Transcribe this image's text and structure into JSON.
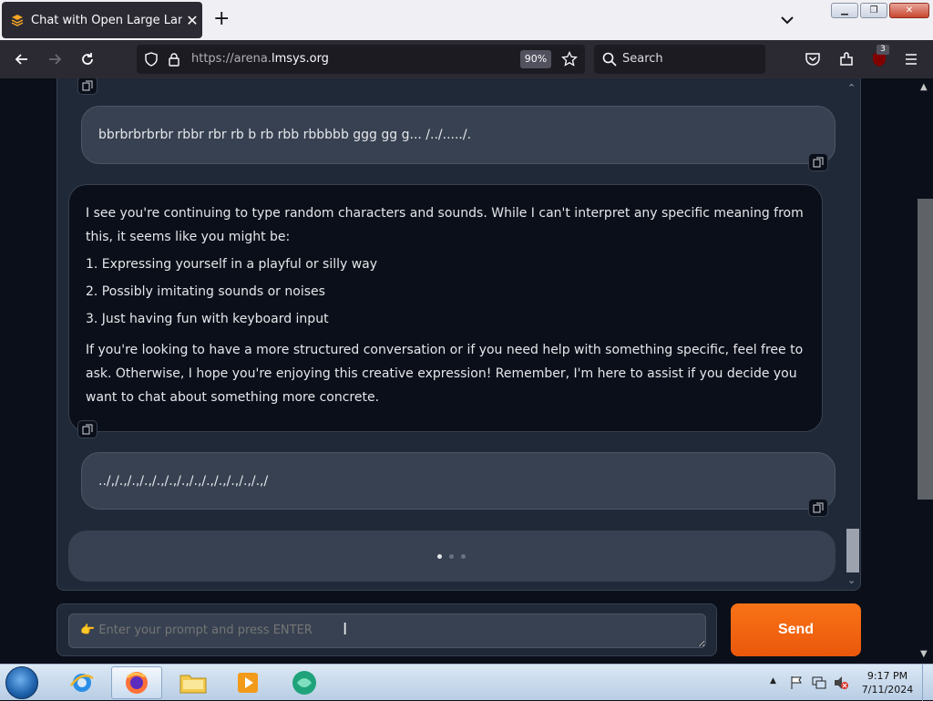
{
  "browser": {
    "tab_title": "Chat with Open Large Languag",
    "url_prefix": "https://arena.",
    "url_domain": "lmsys.org",
    "zoom": "90%",
    "search_placeholder": "Search",
    "extension_badge": "3"
  },
  "chat": {
    "user_message_1": "bbrbrbrbrbr rbbr rbr rb b rb rbb rbbbbb ggg gg g... /../...../.",
    "bot_intro": "I see you're continuing to type random characters and sounds. While I can't interpret any specific meaning from this, it seems like you might be:",
    "bot_list": [
      "1. Expressing yourself in a playful or silly way",
      "2. Possibly imitating sounds or noises",
      "3. Just having fun with keyboard input"
    ],
    "bot_outro": "If you're looking to have a more structured conversation or if you need help with something specific, feel free to ask. Otherwise, I hope you're enjoying this creative expression! Remember, I'm here to assist if you decide you want to chat about something more concrete.",
    "user_message_2": "../,/.,/.,/.,/.,/.,/.,/.,/.,/.,/.,/.,/.,/"
  },
  "input": {
    "placeholder": "👉 Enter your prompt and press ENTER",
    "send_label": "Send"
  },
  "taskbar": {
    "time": "9:17 PM",
    "date": "7/11/2024"
  },
  "colors": {
    "accent": "#f97316",
    "page_bg": "#0b0f19",
    "panel_bg": "#1f2937"
  }
}
